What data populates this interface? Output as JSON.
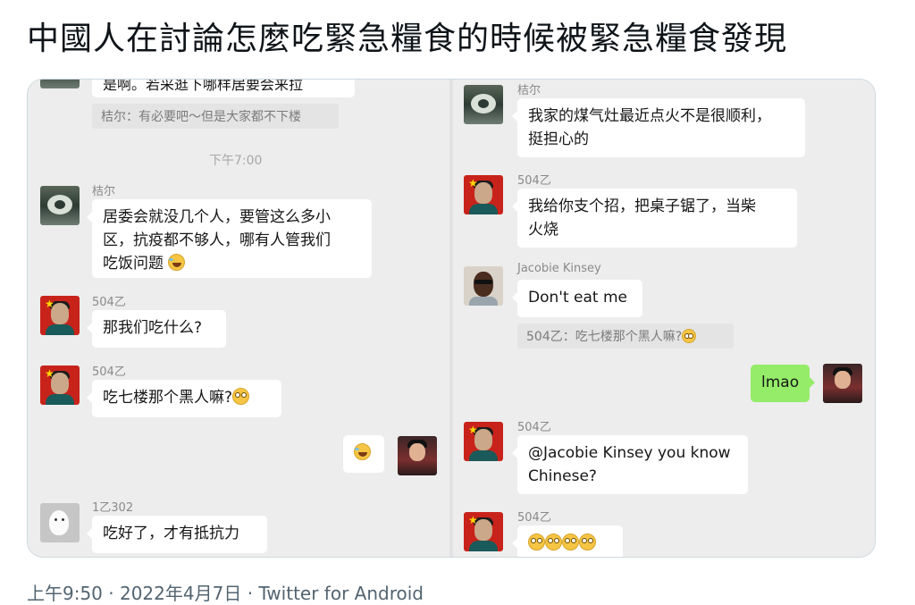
{
  "title": "中國人在討論怎麼吃緊急糧食的時候被緊急糧食發現",
  "left_panel": {
    "partial_top_text": "是啊。若采逛下哪样居要会来拉",
    "quote1": "桔尔：有必要吧～但是大家都不下楼",
    "timestamp": "下午7:00",
    "msg1": {
      "name": "桔尔",
      "lines": [
        "居委会就没几个人，要管这么多小",
        "区，抗疫都不够人，哪有人管我们",
        "吃饭问题"
      ]
    },
    "msg2": {
      "name": "504乙",
      "text": "那我们吃什么?"
    },
    "msg3": {
      "name": "504乙",
      "text": "吃七楼那个黑人嘛?"
    },
    "msg5": {
      "name": "1乙302",
      "text": "吃好了，才有抵抗力"
    }
  },
  "right_panel": {
    "msg1": {
      "name": "桔尔",
      "lines": [
        "我家的煤气灶最近点火不是很顺利，",
        "挺担心的"
      ]
    },
    "msg2": {
      "name": "504乙",
      "lines": [
        "我给你支个招，把桌子锯了，当柴",
        "火烧"
      ]
    },
    "msg3": {
      "name": "Jacobie Kinsey",
      "text": "Don't eat me"
    },
    "quote": "504乙：吃七楼那个黑人嘛?",
    "msg4": {
      "text": "lmao"
    },
    "msg5": {
      "name": "504乙",
      "lines": [
        "@Jacobie Kinsey you know",
        "Chinese?"
      ]
    },
    "msg6": {
      "name": "504乙"
    }
  },
  "footer": "上午9:50 · 2022年4月7日 · Twitter for Android"
}
